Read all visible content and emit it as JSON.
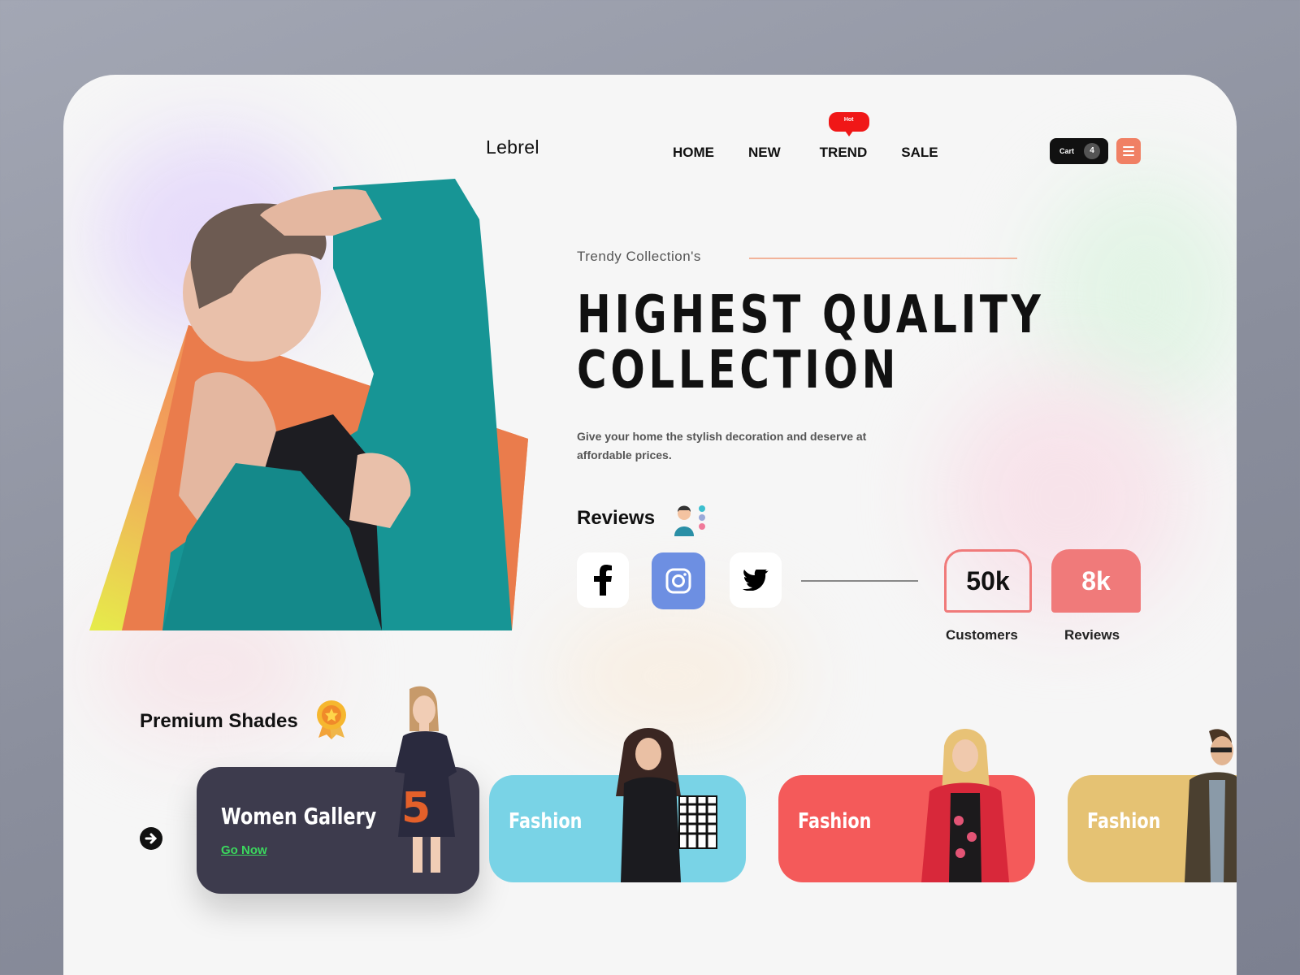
{
  "brand": {
    "logo": "Lebrel"
  },
  "nav": {
    "items": [
      "HOME",
      "NEW",
      "TREND",
      "SALE"
    ],
    "hot_badge": "Hot"
  },
  "cart": {
    "label": "Cart",
    "count": "4"
  },
  "hero": {
    "subtitle": "Trendy Collection's",
    "headline_line1": "HIGHEST QUALITY",
    "headline_line2": "COLLECTION",
    "description": "Give your home the stylish decoration and deserve at affordable prices."
  },
  "reviews": {
    "title": "Reviews",
    "social": [
      "facebook-icon",
      "instagram-icon",
      "twitter-icon"
    ],
    "stats": [
      {
        "value": "50k",
        "label": "Customers"
      },
      {
        "value": "8k",
        "label": "Reviews"
      }
    ]
  },
  "premium": {
    "title": "Premium Shades",
    "cards": [
      {
        "label": "Women Gallery",
        "link": "Go Now",
        "color": "#3d3b4d"
      },
      {
        "label": "Fashion",
        "color": "#79d3e6"
      },
      {
        "label": "Fashion",
        "color": "#f45a5a"
      },
      {
        "label": "Fashion",
        "color": "#e5c273"
      }
    ]
  },
  "colors": {
    "accent": "#f08064",
    "stat": "#f07a7a",
    "hot": "#f01717",
    "link": "#3bd85e"
  }
}
